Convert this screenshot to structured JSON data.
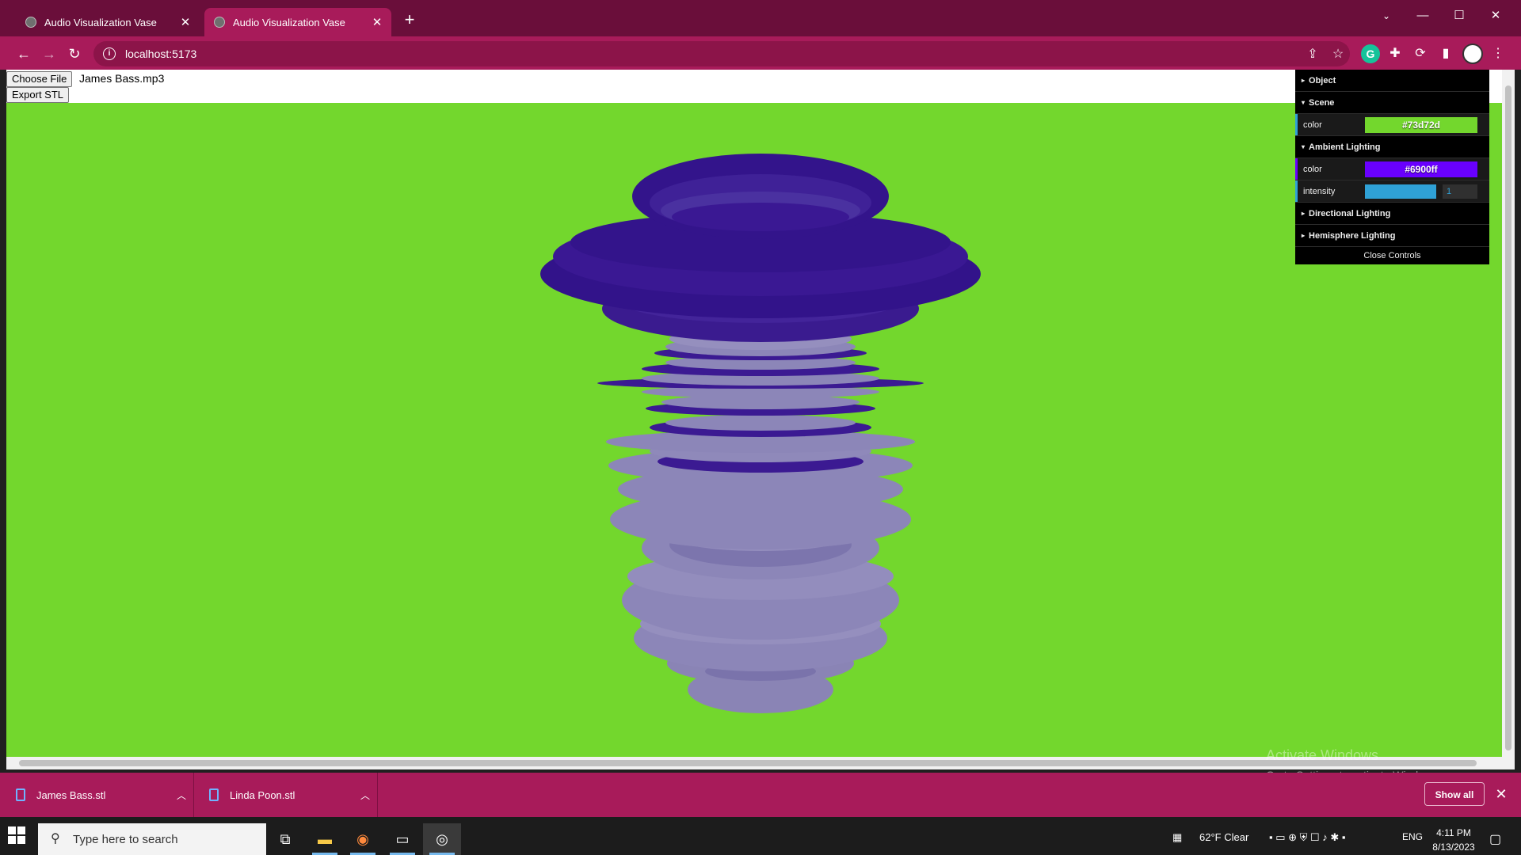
{
  "browser": {
    "tabs": [
      {
        "title": "Audio Visualization Vase",
        "active": false
      },
      {
        "title": "Audio Visualization Vase",
        "active": true
      }
    ],
    "url": "localhost:5173"
  },
  "page": {
    "choose_file_label": "Choose File",
    "file_name": "James Bass.mp3",
    "export_label": "Export STL",
    "scene_color": "#73d72d"
  },
  "controls": {
    "object_label": "Object",
    "scene_label": "Scene",
    "scene_color_label": "color",
    "scene_color_value": "#73d72d",
    "ambient_label": "Ambient Lighting",
    "ambient_color_label": "color",
    "ambient_color_value": "#6900ff",
    "intensity_label": "intensity",
    "intensity_value": "1",
    "directional_label": "Directional Lighting",
    "hemisphere_label": "Hemisphere Lighting",
    "close_label": "Close Controls"
  },
  "watermark": {
    "line1": "Activate Windows",
    "line2": "Go to Settings to activate Windows."
  },
  "downloads": {
    "items": [
      {
        "name": "James Bass.stl"
      },
      {
        "name": "Linda Poon.stl"
      }
    ],
    "show_all_label": "Show all"
  },
  "taskbar": {
    "search_placeholder": "Type here to search",
    "weather": "62°F  Clear",
    "language": "ENG",
    "time": "4:11 PM",
    "date": "8/13/2023"
  }
}
